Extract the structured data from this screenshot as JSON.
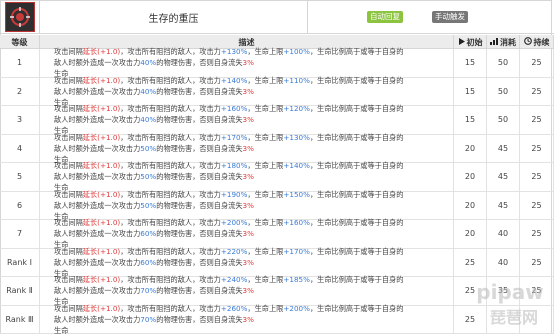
{
  "skill": {
    "name": "生存的重压",
    "tags": {
      "auto": "自动回复",
      "manual": "手动触发"
    }
  },
  "table": {
    "headers": {
      "level": "等级",
      "desc": "描述",
      "init": "初始",
      "cost": "消耗",
      "duration": "持续"
    },
    "rows": [
      {
        "level": "1",
        "a": "攻击间隔",
        "b": "延长(+1.0)",
        "c": "，攻击所有阻挡的敌人，攻击力",
        "d": "+130%",
        "e": "，生命上限",
        "f": "+100%",
        "g": "，生命比例高于或等于自身的",
        "h": "敌人时额外造成一次攻击力",
        "i": "40%",
        "j": "的物理伤害，否则自身流失",
        "k": "3%",
        "l": "生命",
        "init": "15",
        "cost": "50",
        "duration": "25"
      },
      {
        "level": "2",
        "a": "攻击间隔",
        "b": "延长(+1.0)",
        "c": "，攻击所有阻挡的敌人，攻击力",
        "d": "+140%",
        "e": "，生命上限",
        "f": "+110%",
        "g": "，生命比例高于或等于自身的",
        "h": "敌人时额外造成一次攻击力",
        "i": "40%",
        "j": "的物理伤害，否则自身流失",
        "k": "3%",
        "l": "生命",
        "init": "15",
        "cost": "50",
        "duration": "25"
      },
      {
        "level": "3",
        "a": "攻击间隔",
        "b": "延长(+1.0)",
        "c": "，攻击所有阻挡的敌人，攻击力",
        "d": "+160%",
        "e": "，生命上限",
        "f": "+120%",
        "g": "，生命比例高于或等于自身的",
        "h": "敌人时额外造成一次攻击力",
        "i": "40%",
        "j": "的物理伤害，否则自身流失",
        "k": "3%",
        "l": "生命",
        "init": "15",
        "cost": "50",
        "duration": "25"
      },
      {
        "level": "4",
        "a": "攻击间隔",
        "b": "延长(+1.0)",
        "c": "，攻击所有阻挡的敌人，攻击力",
        "d": "+170%",
        "e": "，生命上限",
        "f": "+130%",
        "g": "，生命比例高于或等于自身的",
        "h": "敌人时额外造成一次攻击力",
        "i": "50%",
        "j": "的物理伤害，否则自身流失",
        "k": "3%",
        "l": "生命",
        "init": "20",
        "cost": "45",
        "duration": "25"
      },
      {
        "level": "5",
        "a": "攻击间隔",
        "b": "延长(+1.0)",
        "c": "，攻击所有阻挡的敌人，攻击力",
        "d": "+180%",
        "e": "，生命上限",
        "f": "+140%",
        "g": "，生命比例高于或等于自身的",
        "h": "敌人时额外造成一次攻击力",
        "i": "50%",
        "j": "的物理伤害，否则自身流失",
        "k": "3%",
        "l": "生命",
        "init": "20",
        "cost": "45",
        "duration": "25"
      },
      {
        "level": "6",
        "a": "攻击间隔",
        "b": "延长(+1.0)",
        "c": "，攻击所有阻挡的敌人，攻击力",
        "d": "+190%",
        "e": "，生命上限",
        "f": "+150%",
        "g": "，生命比例高于或等于自身的",
        "h": "敌人时额外造成一次攻击力",
        "i": "50%",
        "j": "的物理伤害，否则自身流失",
        "k": "3%",
        "l": "生命",
        "init": "20",
        "cost": "45",
        "duration": "25"
      },
      {
        "level": "7",
        "a": "攻击间隔",
        "b": "延长(+1.0)",
        "c": "，攻击所有阻挡的敌人，攻击力",
        "d": "+200%",
        "e": "，生命上限",
        "f": "+160%",
        "g": "，生命比例高于或等于自身的",
        "h": "敌人时额外造成一次攻击力",
        "i": "60%",
        "j": "的物理伤害，否则自身流失",
        "k": "3%",
        "l": "生命",
        "init": "20",
        "cost": "40",
        "duration": "25"
      },
      {
        "level": "Rank Ⅰ",
        "a": "攻击间隔",
        "b": "延长(+1.0)",
        "c": "，攻击所有阻挡的敌人，攻击力",
        "d": "+220%",
        "e": "，生命上限",
        "f": "+170%",
        "g": "，生命比例高于或等于自身的",
        "h": "敌人时额外造成一次攻击力",
        "i": "60%",
        "j": "的物理伤害，否则自身流失",
        "k": "3%",
        "l": "生命",
        "init": "25",
        "cost": "40",
        "duration": "25"
      },
      {
        "level": "Rank Ⅱ",
        "a": "攻击间隔",
        "b": "延长(+1.0)",
        "c": "，攻击所有阻挡的敌人，攻击力",
        "d": "+240%",
        "e": "，生命上限",
        "f": "+185%",
        "g": "，生命比例高于或等于自身的",
        "h": "敌人时额外造成一次攻击力",
        "i": "70%",
        "j": "的物理伤害，否则自身流失",
        "k": "3%",
        "l": "生命",
        "init": "25",
        "cost": "35",
        "duration": "25"
      },
      {
        "level": "Rank Ⅲ",
        "a": "攻击间隔",
        "b": "延长(+1.0)",
        "c": "，攻击所有阻挡的敌人，攻击力",
        "d": "+260%",
        "e": "，生命上限",
        "f": "+200%",
        "g": "，生命比例高于或等于自身的",
        "h": "敌人时额外造成一次攻击力",
        "i": "70%",
        "j": "的物理伤害，否则自身流失",
        "k": "3%",
        "l": "生命",
        "init": "25",
        "cost": "",
        "duration": ""
      }
    ]
  },
  "watermark": {
    "brand": "pipaw",
    "cn": "琵琶网"
  },
  "icons": {
    "skill": "skill-emblem-icon",
    "init": "play-icon",
    "cost": "bars-icon",
    "duration": "clock-icon"
  },
  "colors": {
    "accent_red": "#e03a3a",
    "accent_blue": "#3a7bd5",
    "tag_green": "#8cc43f",
    "tag_gray": "#777777"
  }
}
